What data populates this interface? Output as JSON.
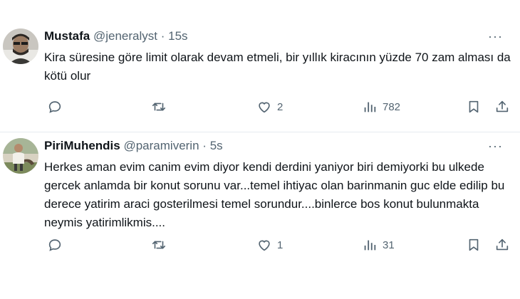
{
  "tweets": [
    {
      "name": "Mustafa",
      "handle": "@jeneralyst",
      "sep": "·",
      "time": "15s",
      "text": "Kira süresine göre limit olarak devam etmeli, bir yıllık kiracının yüzde 70 zam alması da kötü olur",
      "likes": "2",
      "views": "782",
      "icons": [
        "reply-icon",
        "retweet-icon",
        "like-icon",
        "views-icon",
        "bookmark-icon",
        "share-icon",
        "more-icon"
      ]
    },
    {
      "name": "PiriMuhendis",
      "handle": "@paramiverin",
      "sep": "·",
      "time": "5s",
      "text": "Herkes aman evim canim evim diyor kendi derdini yaniyor biri demiyorki bu ulkede gercek anlamda bir konut sorunu var...temel ihtiyac olan barinmanin guc elde edilip bu derece yatirim araci gosterilmesi temel sorundur....binlerce bos konut bulunmakta neymis yatirimlikmis....",
      "likes": "1",
      "views": "31",
      "icons": [
        "reply-icon",
        "retweet-icon",
        "like-icon",
        "views-icon",
        "bookmark-icon",
        "share-icon",
        "more-icon"
      ]
    }
  ],
  "more_glyph": "···",
  "colors": {
    "text": "#0f1419",
    "muted": "#536471",
    "divider": "#e6ecf0"
  }
}
